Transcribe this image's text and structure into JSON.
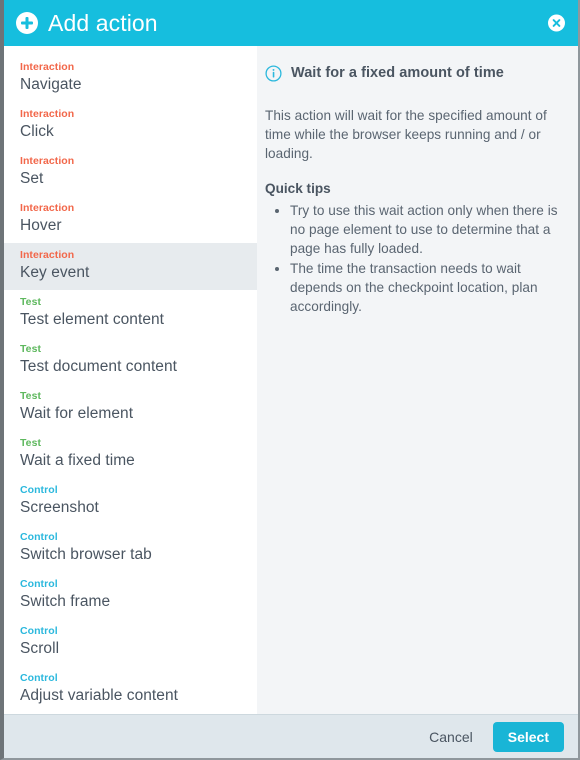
{
  "header": {
    "title": "Add action",
    "add_icon": "plus-circle-icon",
    "close_icon": "close-icon",
    "background_color": "#16bede"
  },
  "category_colors": {
    "Interaction": "#f2674a",
    "Test": "#5eb85e",
    "Control": "#2bb8dd"
  },
  "action_list": [
    {
      "category": "Interaction",
      "label": "Navigate",
      "selected": false
    },
    {
      "category": "Interaction",
      "label": "Click",
      "selected": false
    },
    {
      "category": "Interaction",
      "label": "Set",
      "selected": false
    },
    {
      "category": "Interaction",
      "label": "Hover",
      "selected": false
    },
    {
      "category": "Interaction",
      "label": "Key event",
      "selected": true
    },
    {
      "category": "Test",
      "label": "Test element content",
      "selected": false
    },
    {
      "category": "Test",
      "label": "Test document content",
      "selected": false
    },
    {
      "category": "Test",
      "label": "Wait for element",
      "selected": false
    },
    {
      "category": "Test",
      "label": "Wait a fixed time",
      "selected": false
    },
    {
      "category": "Control",
      "label": "Screenshot",
      "selected": false
    },
    {
      "category": "Control",
      "label": "Switch browser tab",
      "selected": false
    },
    {
      "category": "Control",
      "label": "Switch frame",
      "selected": false
    },
    {
      "category": "Control",
      "label": "Scroll",
      "selected": false
    },
    {
      "category": "Control",
      "label": "Adjust variable content",
      "selected": false
    }
  ],
  "detail": {
    "info_icon": "info-circle-icon",
    "title": "Wait for a fixed amount of time",
    "description": "This action will wait for the specified amount of time while the browser keeps running and / or loading.",
    "tips_title": "Quick tips",
    "tips": [
      "Try to use this wait action only when there is no page element to use to determine that a page has fully loaded.",
      "The time the transaction needs to wait depends on the checkpoint location, plan accordingly."
    ]
  },
  "footer": {
    "cancel_label": "Cancel",
    "select_label": "Select",
    "select_color": "#19b5d6"
  }
}
